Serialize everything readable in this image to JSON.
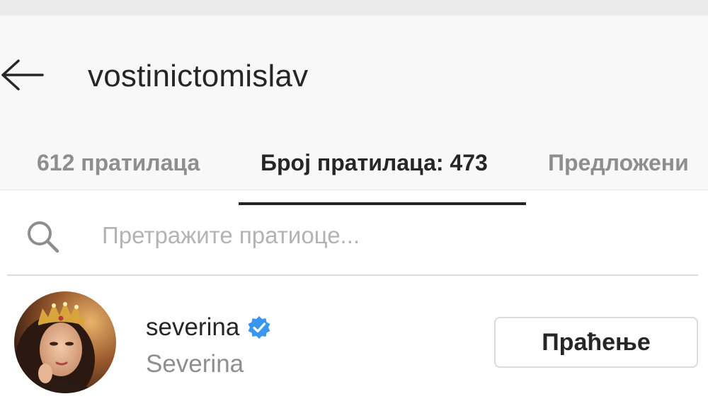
{
  "header": {
    "back_icon": "arrow-left-icon",
    "title": "vostinictomislav"
  },
  "tabs": [
    {
      "label": "612 пратилаца",
      "active": false
    },
    {
      "label": "Број пратилаца: 473",
      "active": true
    },
    {
      "label": "Предложени",
      "active": false
    }
  ],
  "search": {
    "icon": "search-icon",
    "placeholder": "Претражите пратиоце...",
    "value": ""
  },
  "list": [
    {
      "username": "severina",
      "verified": true,
      "full_name": "Severina",
      "button_label": "Праћење"
    }
  ],
  "colors": {
    "primary_text": "#262626",
    "secondary_text": "#8e8e8e",
    "placeholder": "#b3b3b3",
    "header_bg": "#f8f8f8",
    "verified_blue": "#3897f0",
    "button_border": "#dbdbdb"
  }
}
